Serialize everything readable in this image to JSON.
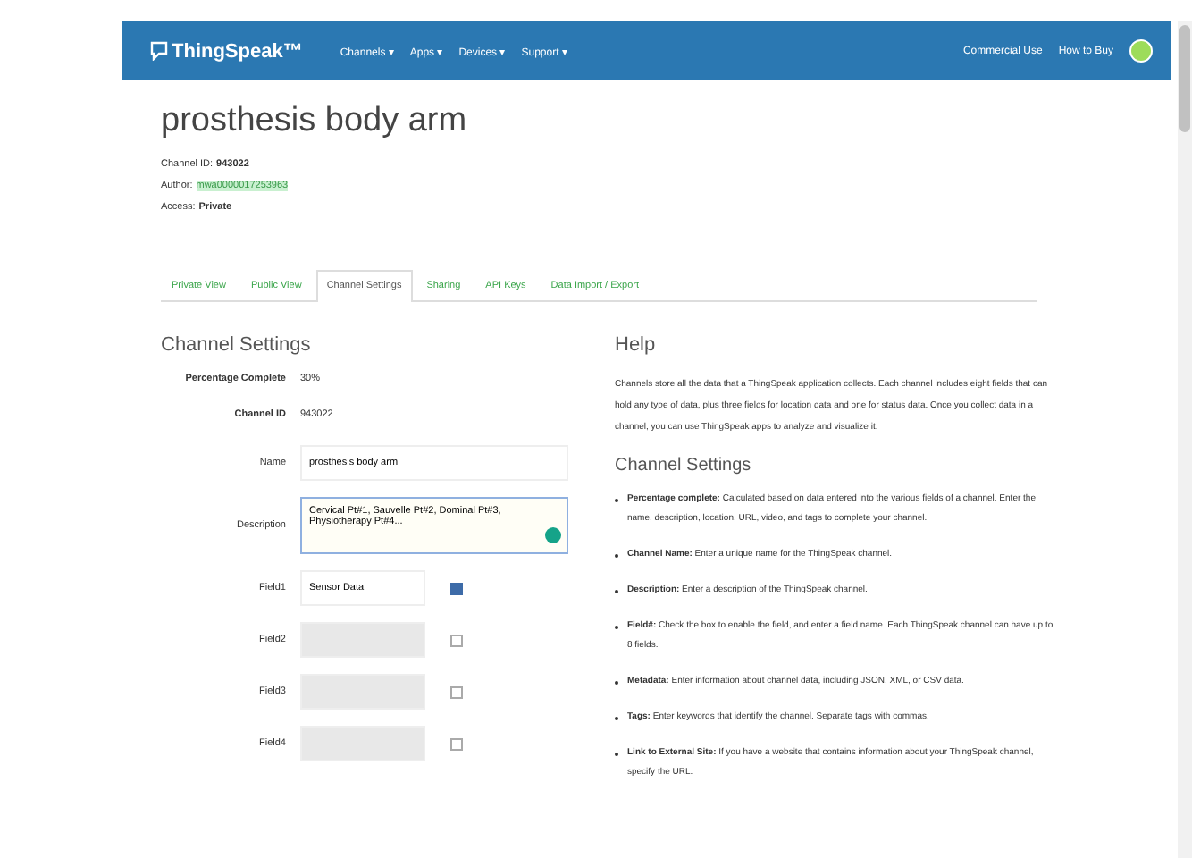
{
  "navbar": {
    "logo": "ThingSpeak™",
    "menus": [
      {
        "label": "Channels ▾"
      },
      {
        "label": "Apps ▾"
      },
      {
        "label": "Devices ▾"
      },
      {
        "label": "Support ▾"
      }
    ],
    "right_links": [
      "Commercial Use",
      "How to Buy"
    ]
  },
  "channel": {
    "title": "prosthesis body arm",
    "meta": [
      {
        "label": "Channel ID:",
        "value": "943022"
      },
      {
        "label": "Author:",
        "value": "mwa0000017253963"
      },
      {
        "label": "Access:",
        "value": "Private"
      }
    ]
  },
  "tabs": [
    {
      "label": "Private View",
      "selected": false
    },
    {
      "label": "Public View",
      "selected": false
    },
    {
      "label": "Channel Settings",
      "selected": true
    },
    {
      "label": "Sharing",
      "selected": false
    },
    {
      "label": "API Keys",
      "selected": false
    },
    {
      "label": "Data Import / Export",
      "selected": false
    }
  ],
  "settings": {
    "heading": "Channel Settings",
    "info": [
      {
        "label": "Percentage Complete",
        "value": "30%"
      },
      {
        "label": "Channel ID",
        "value": "943022"
      }
    ],
    "name": {
      "label": "Name",
      "value": "prosthesis body arm"
    },
    "description": {
      "label": "Description",
      "value": "Cervical Pt#1, Sauvelle Pt#2, Dominal Pt#3, Physiotherapy Pt#4..."
    },
    "fields": [
      {
        "label": "Field1",
        "value": "Sensor Data",
        "checked": true
      },
      {
        "label": "Field2",
        "checked": false
      },
      {
        "label": "Field3",
        "checked": false
      },
      {
        "label": "Field4",
        "checked": false
      }
    ]
  },
  "help": {
    "heading": "Help",
    "intro": "Channels store all the data that a ThingSpeak application collects. Each channel includes eight fields that can hold any type of data, plus three fields for location data and one for status data. Once you collect data in a channel, you can use ThingSpeak apps to analyze and visualize it.",
    "subheading": "Channel Settings",
    "items": [
      {
        "text": "**Percentage complete:** Calculated based on data entered into the various fields of a channel. Enter the name, description, location, URL, video, and tags to complete your channel."
      },
      {
        "text": "**Channel Name:** Enter a unique name for the ThingSpeak channel."
      },
      {
        "text": "**Description:** Enter a description of the ThingSpeak channel."
      },
      {
        "text": "**Field#:** Check the box to enable the field, and enter a field name. Each ThingSpeak channel can have up to 8 fields."
      },
      {
        "text": "**Metadata:** Enter information about channel data, including JSON, XML, or CSV data."
      },
      {
        "text": "**Tags:** Enter keywords that identify the channel. Separate tags with commas."
      },
      {
        "text": "**Link to External Site:** If you have a website that contains information about your ThingSpeak channel, specify the URL."
      }
    ]
  }
}
